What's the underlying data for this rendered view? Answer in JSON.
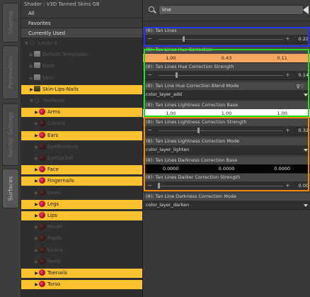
{
  "side_tabs": [
    "Shaping",
    "Parameters",
    "Render Settings",
    "Surfaces"
  ],
  "left_panel": {
    "title": "Shader : V3D Tanned Skins G8",
    "filters": [
      "All",
      "Favorites",
      "Currently Used"
    ],
    "tree": [
      {
        "label": "Looks 3",
        "indent": 0,
        "tri": "▼",
        "icon": "figure",
        "style": "dim"
      },
      {
        "label": "Default Templates",
        "indent": 1,
        "tri": "▶",
        "icon": "folder",
        "style": "dim"
      },
      {
        "label": "Nails",
        "indent": 1,
        "tri": "▶",
        "icon": "folder",
        "style": "dim"
      },
      {
        "label": "Skin",
        "indent": 1,
        "tri": "▶",
        "icon": "folder",
        "style": "dim"
      },
      {
        "label": "Skin-Lips-Nails",
        "indent": 1,
        "tri": "▶",
        "icon": "folder",
        "style": "hl"
      },
      {
        "label": "Surfaces",
        "indent": 1,
        "tri": "▼",
        "icon": "figure",
        "style": "dim"
      },
      {
        "label": "Arms",
        "indent": 2,
        "tri": "▶",
        "icon": "surface",
        "style": "hl"
      },
      {
        "label": "Cornea",
        "indent": 2,
        "tri": "▶",
        "icon": "surface",
        "style": "dim"
      },
      {
        "label": "Ears",
        "indent": 2,
        "tri": "▶",
        "icon": "surface",
        "style": "hl"
      },
      {
        "label": "EyeMoisture",
        "indent": 2,
        "tri": "▶",
        "icon": "surface",
        "style": "dim"
      },
      {
        "label": "EyeSocket",
        "indent": 2,
        "tri": "▶",
        "icon": "surface",
        "style": "dim"
      },
      {
        "label": "Face",
        "indent": 2,
        "tri": "▶",
        "icon": "surface",
        "style": "hl"
      },
      {
        "label": "Fingernails",
        "indent": 2,
        "tri": "▶",
        "icon": "surface",
        "style": "hl"
      },
      {
        "label": "Irises",
        "indent": 2,
        "tri": "▶",
        "icon": "surface",
        "style": "dim"
      },
      {
        "label": "Legs",
        "indent": 2,
        "tri": "▶",
        "icon": "surface",
        "style": "hl"
      },
      {
        "label": "Lips",
        "indent": 2,
        "tri": "▶",
        "icon": "surface",
        "style": "hl"
      },
      {
        "label": "Mouth",
        "indent": 2,
        "tri": "▶",
        "icon": "surface",
        "style": "dim"
      },
      {
        "label": "Pupils",
        "indent": 2,
        "tri": "▶",
        "icon": "surface",
        "style": "dim"
      },
      {
        "label": "Sclera",
        "indent": 2,
        "tri": "▶",
        "icon": "surface",
        "style": "dim"
      },
      {
        "label": "Teeth",
        "indent": 2,
        "tri": "▶",
        "icon": "surface",
        "style": "dim"
      },
      {
        "label": "Toenails",
        "indent": 2,
        "tri": "▶",
        "icon": "surface",
        "style": "hl"
      },
      {
        "label": "Torso",
        "indent": 2,
        "tri": "▶",
        "icon": "surface",
        "style": "hl"
      }
    ]
  },
  "search": {
    "value": "line"
  },
  "properties": {
    "p1": {
      "label": "(8): Tan Lines",
      "value": "0.22",
      "fraction": 0.2
    },
    "p2": {
      "label": "(8): Tan Lines Hue Correction",
      "values": [
        "1.00",
        "0.43",
        "0.11"
      ]
    },
    "p3": {
      "label": "(8): Tan Lines Hue Correction Strength",
      "value": "0.14",
      "fraction": 0.14
    },
    "p4": {
      "label": "(8): Tan Line Hue Correction Blend Mode",
      "value": "color_layer_add"
    },
    "p5": {
      "label": "(8): Tan Lines Lightness Correction Base",
      "values": [
        "1.00",
        "1.00",
        "1.00"
      ]
    },
    "p6": {
      "label": "(8): Tan Lines Lightness Correction Strength",
      "value": "0.32",
      "fraction": 0.32
    },
    "p7": {
      "label": "(8): Tan Lines Lightness Correction Mode",
      "value": "color_layer_lighten"
    },
    "p8": {
      "label": "(8): Tan Lines Darkness Correction Base",
      "values": [
        "0.0000",
        "0.0000",
        "0.0000"
      ]
    },
    "p9": {
      "label": "(8): Tan Lines Darker Correction Strength",
      "value": "0.00",
      "fraction": 0.0
    },
    "p10": {
      "label": "(8): Tan Line Darkness Correction Mode",
      "value": "color_layer_darken"
    }
  },
  "colors": {
    "highlight": "#fbc22f",
    "blue_frame": "#2233ff",
    "green_frame": "#22dd22",
    "orange_frame": "#f08a00"
  }
}
